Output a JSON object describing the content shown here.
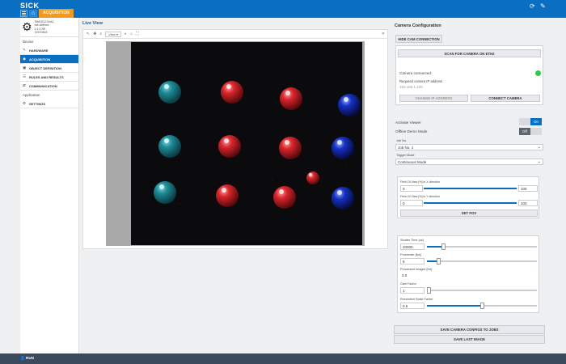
{
  "header": {
    "brand": "SICK",
    "tab": "ACQUISITION"
  },
  "device": {
    "lines": [
      "SIM1012-0xA2",
      "not defined",
      "2.1.0.3R",
      "19370824"
    ]
  },
  "sidebar": {
    "device_title": "Device",
    "application_title": "Application",
    "items": [
      {
        "label": "HARDWARE",
        "icon": "edit-icon"
      },
      {
        "label": "ACQUISITION",
        "icon": "camera-icon"
      },
      {
        "label": "OBJECT DEFINITION",
        "icon": "object-icon"
      },
      {
        "label": "RULES AND RESULTS",
        "icon": "rules-icon"
      },
      {
        "label": "COMMUNICATION",
        "icon": "communication-icon"
      }
    ],
    "settings": "SETTINGS"
  },
  "bottom": {
    "run": "RUN"
  },
  "live_view": {
    "title": "Live View",
    "view_select": "View"
  },
  "config": {
    "title": "Camera Configuration",
    "hide_btn": "HIDE CAM CONNECTION",
    "scan_btn": "SCAN FOR CAMERA ON ETH2",
    "camera_connected": "Camera connected:",
    "required_ip_label": "Required camera IP address",
    "required_ip": "192.168.1.100",
    "change_ip_btn": "CHANGE IP ADDRESS",
    "connect_btn": "CONNECT CAMERA",
    "status_color": "#2ecc40",
    "activate_viewer": "Activate Viewer",
    "activate_state": "On",
    "offline_demo": "Offline Demo Mode",
    "offline_state": "Off",
    "job_label": "Job No.",
    "job_value": "Job No. 1",
    "trigger_label": "Trigger Mode",
    "trigger_value": "Continuous Mode",
    "fov_x_label": "Field Of View [%] in X direction",
    "fov_x_min": "0",
    "fov_x_max": "100",
    "fov_y_label": "Field Of View [%] in Y direction",
    "fov_y_min": "0",
    "fov_y_max": "100",
    "set_fov": "SET FOV",
    "shutter_label": "Shutter Time [us]",
    "shutter_value": "20000",
    "shutter_level": 0.15,
    "framerate_label": "Framerate [fps]",
    "framerate_value": "5",
    "framerate_level": 0.1,
    "processed_label": "Processed Images [Hz]",
    "processed_value": "3.0",
    "gain_label": "Gain Factor",
    "gain_value": "1",
    "gain_level": 0.0,
    "res_label": "Resolution Scale Factor",
    "res_value": "0.5",
    "res_level": 0.5,
    "save_configs": "SAVE CAMERA CONFIGS TO JOBS",
    "save_image": "SAVE LAST IMAGE"
  }
}
